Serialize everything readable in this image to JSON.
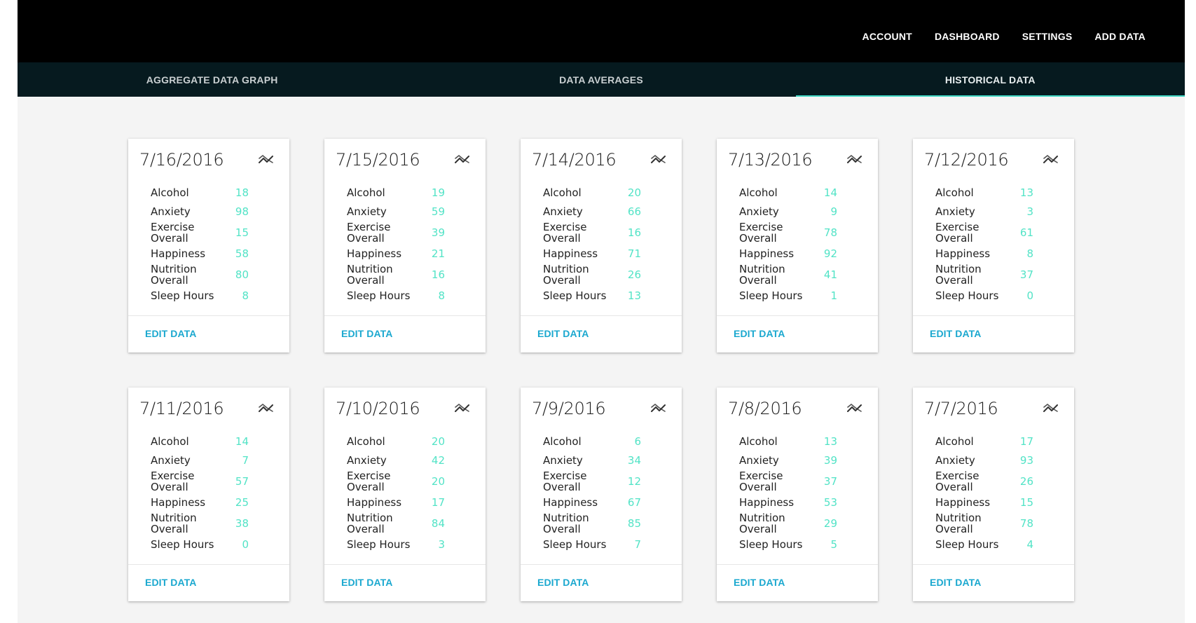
{
  "nav": {
    "account": "ACCOUNT",
    "dashboard": "DASHBOARD",
    "settings": "SETTINGS",
    "add_data": "ADD DATA"
  },
  "tabs": [
    {
      "label": "AGGREGATE DATA GRAPH",
      "active": false
    },
    {
      "label": "DATA AVERAGES",
      "active": false
    },
    {
      "label": "HISTORICAL DATA",
      "active": true
    }
  ],
  "metric_labels": {
    "alcohol": "Alcohol",
    "anxiety": "Anxiety",
    "exercise_1": "Exercise",
    "exercise_2": "Overall",
    "happiness": "Happiness",
    "nutrition_1": "Nutrition",
    "nutrition_2": "Overall",
    "sleep": "Sleep Hours"
  },
  "edit_label": "EDIT DATA",
  "icons": {
    "trend": "trending-icon"
  },
  "colors": {
    "accent": "#3ed6c2",
    "value": "#52e3c6",
    "link": "#1ba8cf"
  },
  "cards": [
    {
      "date": "7/16/2016",
      "alcohol": "18",
      "anxiety": "98",
      "exercise": "15",
      "happiness": "58",
      "nutrition": "80",
      "sleep": "8"
    },
    {
      "date": "7/15/2016",
      "alcohol": "19",
      "anxiety": "59",
      "exercise": "39",
      "happiness": "21",
      "nutrition": "16",
      "sleep": "8"
    },
    {
      "date": "7/14/2016",
      "alcohol": "20",
      "anxiety": "66",
      "exercise": "16",
      "happiness": "71",
      "nutrition": "26",
      "sleep": "13"
    },
    {
      "date": "7/13/2016",
      "alcohol": "14",
      "anxiety": "9",
      "exercise": "78",
      "happiness": "92",
      "nutrition": "41",
      "sleep": "1"
    },
    {
      "date": "7/12/2016",
      "alcohol": "13",
      "anxiety": "3",
      "exercise": "61",
      "happiness": "8",
      "nutrition": "37",
      "sleep": "0"
    },
    {
      "date": "7/11/2016",
      "alcohol": "14",
      "anxiety": "7",
      "exercise": "57",
      "happiness": "25",
      "nutrition": "38",
      "sleep": "0"
    },
    {
      "date": "7/10/2016",
      "alcohol": "20",
      "anxiety": "42",
      "exercise": "20",
      "happiness": "17",
      "nutrition": "84",
      "sleep": "3"
    },
    {
      "date": "7/9/2016",
      "alcohol": "6",
      "anxiety": "34",
      "exercise": "12",
      "happiness": "67",
      "nutrition": "85",
      "sleep": "7"
    },
    {
      "date": "7/8/2016",
      "alcohol": "13",
      "anxiety": "39",
      "exercise": "37",
      "happiness": "53",
      "nutrition": "29",
      "sleep": "5"
    },
    {
      "date": "7/7/2016",
      "alcohol": "17",
      "anxiety": "93",
      "exercise": "26",
      "happiness": "15",
      "nutrition": "78",
      "sleep": "4"
    }
  ]
}
